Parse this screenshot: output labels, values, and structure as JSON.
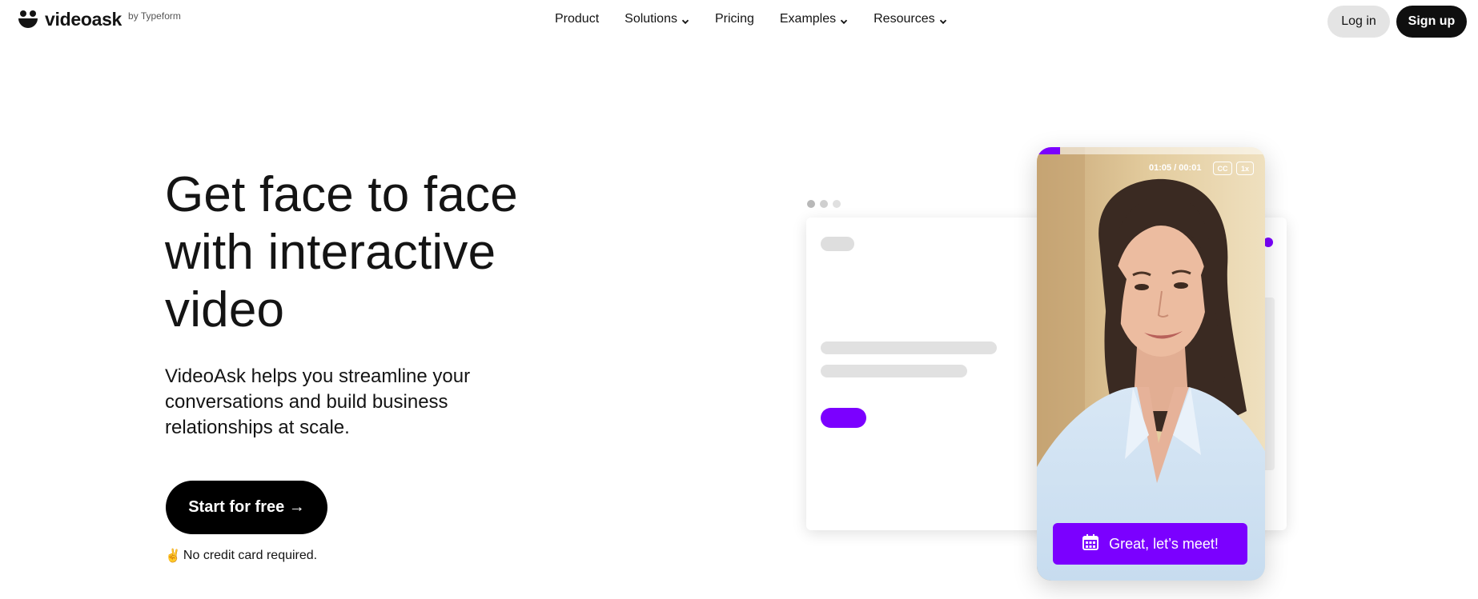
{
  "nav": {
    "logo_text": "videoask",
    "logo_byline": "by Typeform",
    "menu": [
      {
        "label": "Product",
        "has_dropdown": false
      },
      {
        "label": "Solutions",
        "has_dropdown": true
      },
      {
        "label": "Pricing",
        "has_dropdown": false
      },
      {
        "label": "Examples",
        "has_dropdown": true
      },
      {
        "label": "Resources",
        "has_dropdown": true
      }
    ],
    "login_label": "Log in",
    "signup_label": "Sign up"
  },
  "hero": {
    "title": "Get face to face with interactive video",
    "subtitle": "VideoAsk helps you streamline your conversations and build business relationships at scale.",
    "cta_label": "Start for free →",
    "note_emoji": "✌️",
    "note_text": "No credit card required."
  },
  "video": {
    "time": "01:05 / 00:01",
    "cc_label": "CC",
    "speed_label": "1x",
    "progress": 0.1,
    "action_label": "Great, let’s meet!",
    "action_icon": "calendar-icon"
  },
  "colors": {
    "brand_purple": "#7b00ff",
    "text": "#141414",
    "login_bg": "#e4e4e4",
    "signup_bg": "#0f0f0f"
  }
}
